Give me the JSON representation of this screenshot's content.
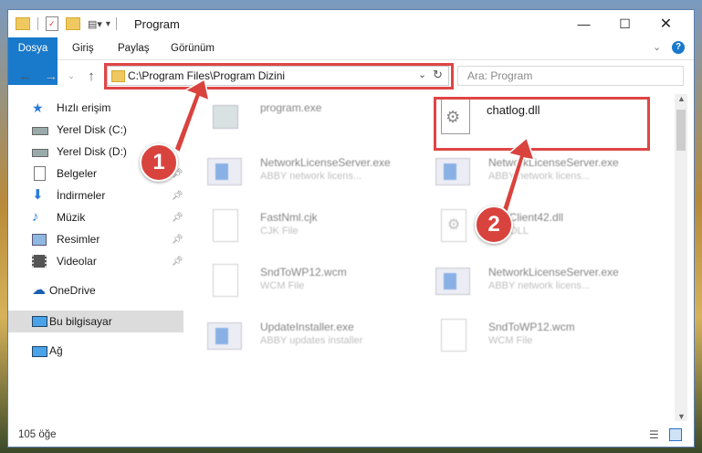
{
  "window": {
    "title": "Program"
  },
  "ribbon": {
    "tabs": [
      "Dosya",
      "Giriş",
      "Paylaş",
      "Görünüm"
    ]
  },
  "address": {
    "path": "C:\\Program Files\\Program Dizini"
  },
  "search": {
    "placeholder": "Ara: Program"
  },
  "sidebar": {
    "items": [
      {
        "label": "Hızlı erişim",
        "icon": "star-icon"
      },
      {
        "label": "Yerel Disk (C:)",
        "icon": "drive-icon"
      },
      {
        "label": "Yerel Disk (D:)",
        "icon": "drive-icon"
      },
      {
        "label": "Belgeler",
        "icon": "documents-icon"
      },
      {
        "label": "İndirmeler",
        "icon": "download-icon"
      },
      {
        "label": "Müzik",
        "icon": "music-icon"
      },
      {
        "label": "Resimler",
        "icon": "pictures-icon"
      },
      {
        "label": "Videolar",
        "icon": "videos-icon"
      },
      {
        "label": "OneDrive",
        "icon": "cloud-icon"
      },
      {
        "label": "Bu bilgisayar",
        "icon": "computer-icon"
      },
      {
        "label": "Ağ",
        "icon": "network-icon"
      }
    ]
  },
  "files": [
    {
      "name": "program.exe",
      "sub": ""
    },
    {
      "name": "chatlog.dll",
      "sub": ""
    },
    {
      "name": "NetworkLicenseServer.exe",
      "sub": "ABBY network licens..."
    },
    {
      "name": "NetworkLicenseServer.exe",
      "sub": "ABBY network licens..."
    },
    {
      "name": "FastNml.cjk",
      "sub": "CJK File"
    },
    {
      "name": "...ceClient42.dll",
      "sub": "...ce DLL"
    },
    {
      "name": "SndToWP12.wcm",
      "sub": "WCM File"
    },
    {
      "name": "NetworkLicenseServer.exe",
      "sub": "ABBY network licens..."
    },
    {
      "name": "UpdateInstaller.exe",
      "sub": "ABBY updates installer"
    },
    {
      "name": "SndToWP12.wcm",
      "sub": "WCM File"
    }
  ],
  "status": {
    "count": "105 öğe"
  },
  "callouts": [
    "1",
    "2"
  ],
  "colors": {
    "accent": "#1979ca",
    "highlight": "#e04545"
  }
}
